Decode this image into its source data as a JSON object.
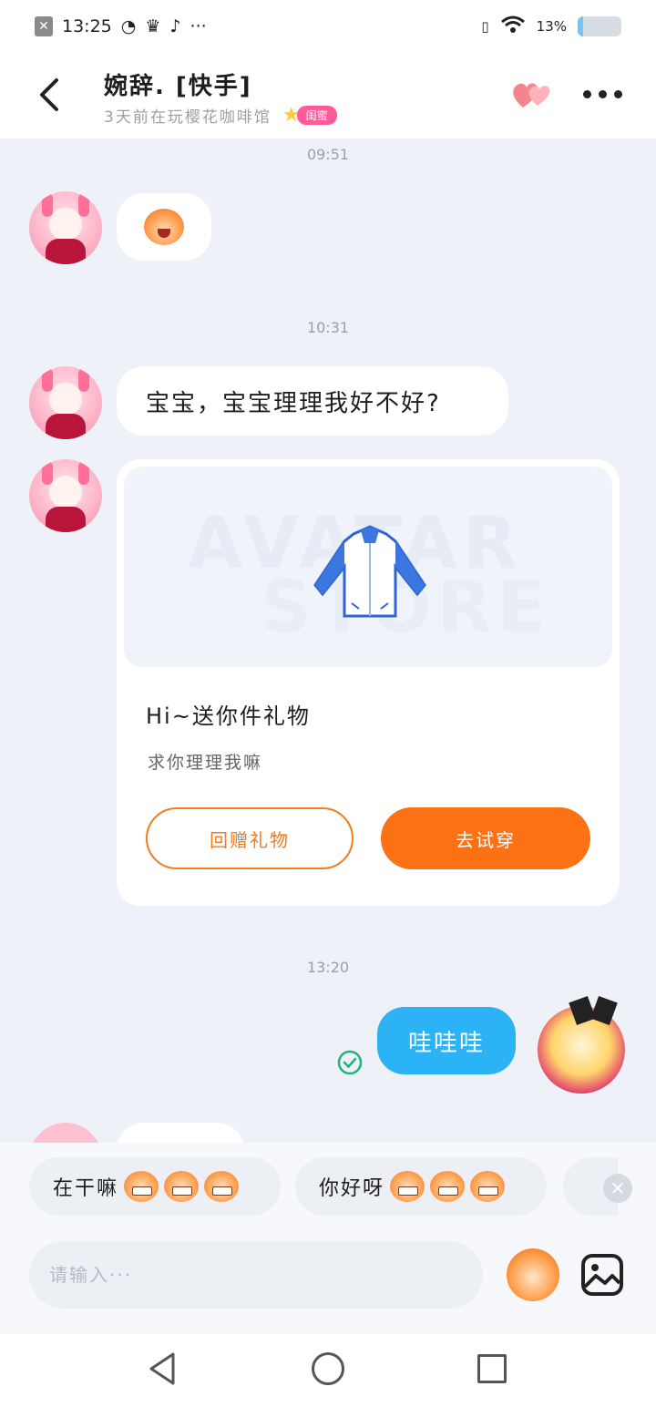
{
  "status_bar": {
    "time": "13:25",
    "battery_text": "13%",
    "battery_level": 0.13,
    "icons": [
      "close-box-icon",
      "speedometer-icon",
      "crown-icon",
      "tiktok-icon",
      "more-dots-icon",
      "vibrate-icon",
      "wifi-icon",
      "battery-icon"
    ]
  },
  "header": {
    "title": "婉辞. [快手]",
    "subtitle": "3天前在玩樱花咖啡馆",
    "badge": "闺蜜"
  },
  "chat": {
    "times": [
      "09:51",
      "10:31",
      "13:20"
    ],
    "messages": {
      "m2_text": "宝宝，宝宝理理我好不好?",
      "my_text": "哇哇哇"
    },
    "gift_card": {
      "watermark_line1": "AVATAR",
      "watermark_line2": "STORE",
      "title": "Hi~送你件礼物",
      "subtitle": "求你理理我嘛",
      "return_gift_label": "回赠礼物",
      "try_on_label": "去试穿"
    }
  },
  "quick_replies": [
    {
      "label": "在干嘛"
    },
    {
      "label": "你好呀"
    }
  ],
  "input": {
    "placeholder": "请输入···"
  },
  "colors": {
    "accent_orange": "#fb7114",
    "my_bubble_blue": "#2cb3f5",
    "badge_pink": "#ff5b9b"
  }
}
